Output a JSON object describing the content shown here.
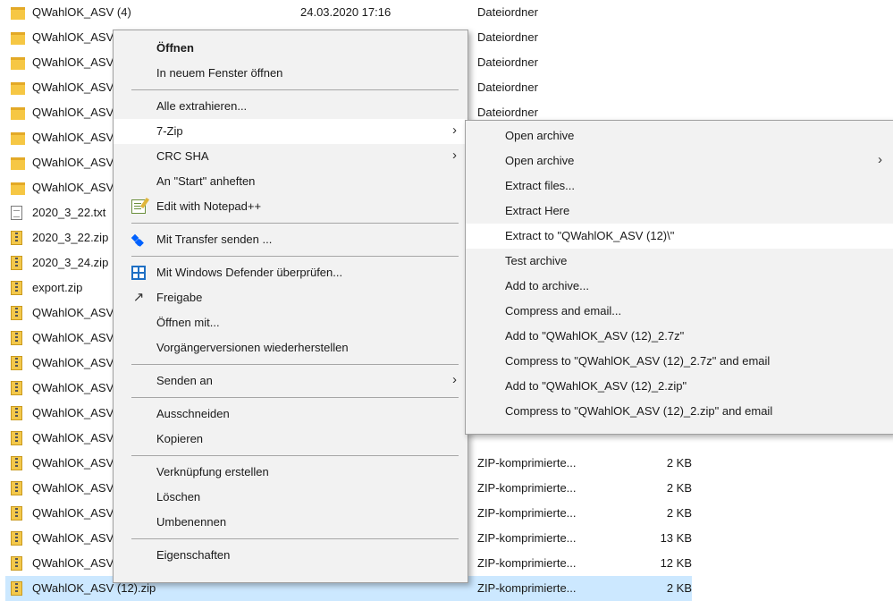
{
  "files": [
    {
      "name": "QWahlOK_ASV (4)",
      "date": "24.03.2020 17:16",
      "type": "Dateiordner",
      "size": "",
      "icon": "folder-icon"
    },
    {
      "name": "QWahlOK_ASV",
      "date": "",
      "type": "Dateiordner",
      "size": "",
      "icon": "folder-icon"
    },
    {
      "name": "QWahlOK_ASV",
      "date": "",
      "type": "Dateiordner",
      "size": "",
      "icon": "folder-icon"
    },
    {
      "name": "QWahlOK_ASV",
      "date": "",
      "type": "Dateiordner",
      "size": "",
      "icon": "folder-icon"
    },
    {
      "name": "QWahlOK_ASV",
      "date": "",
      "type": "Dateiordner",
      "size": "",
      "icon": "folder-icon"
    },
    {
      "name": "QWahlOK_ASV",
      "date": "",
      "type": "",
      "size": "",
      "icon": "folder-icon"
    },
    {
      "name": "QWahlOK_ASV",
      "date": "",
      "type": "",
      "size": "",
      "icon": "folder-icon"
    },
    {
      "name": "QWahlOK_ASV",
      "date": "",
      "type": "",
      "size": "",
      "icon": "folder-icon"
    },
    {
      "name": "2020_3_22.txt",
      "date": "",
      "type": "",
      "size": "",
      "icon": "text-file-icon"
    },
    {
      "name": "2020_3_22.zip",
      "date": "",
      "type": "",
      "size": "",
      "icon": "zip-file-icon"
    },
    {
      "name": "2020_3_24.zip",
      "date": "",
      "type": "",
      "size": "",
      "icon": "zip-file-icon"
    },
    {
      "name": "export.zip",
      "date": "",
      "type": "",
      "size": "",
      "icon": "zip-file-icon"
    },
    {
      "name": "QWahlOK_ASV",
      "date": "",
      "type": "",
      "size": "",
      "icon": "zip-file-icon"
    },
    {
      "name": "QWahlOK_ASV",
      "date": "",
      "type": "",
      "size": "",
      "icon": "zip-file-icon"
    },
    {
      "name": "QWahlOK_ASV",
      "date": "",
      "type": "",
      "size": "",
      "icon": "zip-file-icon"
    },
    {
      "name": "QWahlOK_ASV",
      "date": "",
      "type": "",
      "size": "",
      "icon": "zip-file-icon"
    },
    {
      "name": "QWahlOK_ASV",
      "date": "",
      "type": "",
      "size": "",
      "icon": "zip-file-icon"
    },
    {
      "name": "QWahlOK_ASV",
      "date": "",
      "type": "",
      "size": "",
      "icon": "zip-file-icon"
    },
    {
      "name": "QWahlOK_ASV",
      "date": "",
      "type": "ZIP-komprimierte...",
      "size": "2 KB",
      "icon": "zip-file-icon"
    },
    {
      "name": "QWahlOK_ASV",
      "date": "",
      "type": "ZIP-komprimierte...",
      "size": "2 KB",
      "icon": "zip-file-icon"
    },
    {
      "name": "QWahlOK_ASV",
      "date": "",
      "type": "ZIP-komprimierte...",
      "size": "2 KB",
      "icon": "zip-file-icon"
    },
    {
      "name": "QWahlOK_ASV",
      "date": "",
      "type": "ZIP-komprimierte...",
      "size": "13 KB",
      "icon": "zip-file-icon"
    },
    {
      "name": "QWahlOK_ASV",
      "date": "",
      "type": "ZIP-komprimierte...",
      "size": "12 KB",
      "icon": "zip-file-icon"
    },
    {
      "name": "QWahlOK_ASV (12).zip",
      "date": "",
      "type": "ZIP-komprimierte...",
      "size": "2 KB",
      "icon": "zip-file-icon",
      "selected": true
    }
  ],
  "context_menu": {
    "items": [
      {
        "label": "Öffnen",
        "bold": true
      },
      {
        "label": "In neuem Fenster öffnen"
      },
      {
        "separator": true
      },
      {
        "label": "Alle extrahieren..."
      },
      {
        "label": "7-Zip",
        "submenu": true,
        "hover": true
      },
      {
        "label": "CRC SHA",
        "submenu": true
      },
      {
        "label": "An \"Start\" anheften"
      },
      {
        "label": "Edit with Notepad++",
        "icon": "notepad-plus-plus-icon"
      },
      {
        "separator": true
      },
      {
        "label": "Mit Transfer senden ...",
        "icon": "dropbox-icon"
      },
      {
        "separator": true
      },
      {
        "label": "Mit Windows Defender überprüfen...",
        "icon": "windows-defender-icon"
      },
      {
        "label": "Freigabe",
        "icon": "share-icon"
      },
      {
        "label": "Öffnen mit..."
      },
      {
        "label": "Vorgängerversionen wiederherstellen"
      },
      {
        "separator": true
      },
      {
        "label": "Senden an",
        "submenu": true
      },
      {
        "separator": true
      },
      {
        "label": "Ausschneiden"
      },
      {
        "label": "Kopieren"
      },
      {
        "separator": true
      },
      {
        "label": "Verknüpfung erstellen"
      },
      {
        "label": "Löschen"
      },
      {
        "label": "Umbenennen"
      },
      {
        "separator": true
      },
      {
        "label": "Eigenschaften"
      }
    ]
  },
  "sevenzip_submenu": {
    "items": [
      {
        "label": "Open archive"
      },
      {
        "label": "Open archive",
        "submenu": true
      },
      {
        "label": "Extract files..."
      },
      {
        "label": "Extract Here"
      },
      {
        "label": "Extract to \"QWahlOK_ASV (12)\\\"",
        "hover": true
      },
      {
        "label": "Test archive"
      },
      {
        "label": "Add to archive..."
      },
      {
        "label": "Compress and email..."
      },
      {
        "label": "Add to \"QWahlOK_ASV (12)_2.7z\""
      },
      {
        "label": "Compress to \"QWahlOK_ASV (12)_2.7z\" and email"
      },
      {
        "label": "Add to \"QWahlOK_ASV (12)_2.zip\""
      },
      {
        "label": "Compress to \"QWahlOK_ASV (12)_2.zip\" and email"
      }
    ]
  },
  "colors": {
    "selection": "#cce8ff",
    "menu_background": "#f2f2f2",
    "menu_hover": "#ffffff",
    "folder": "#f6c744"
  }
}
